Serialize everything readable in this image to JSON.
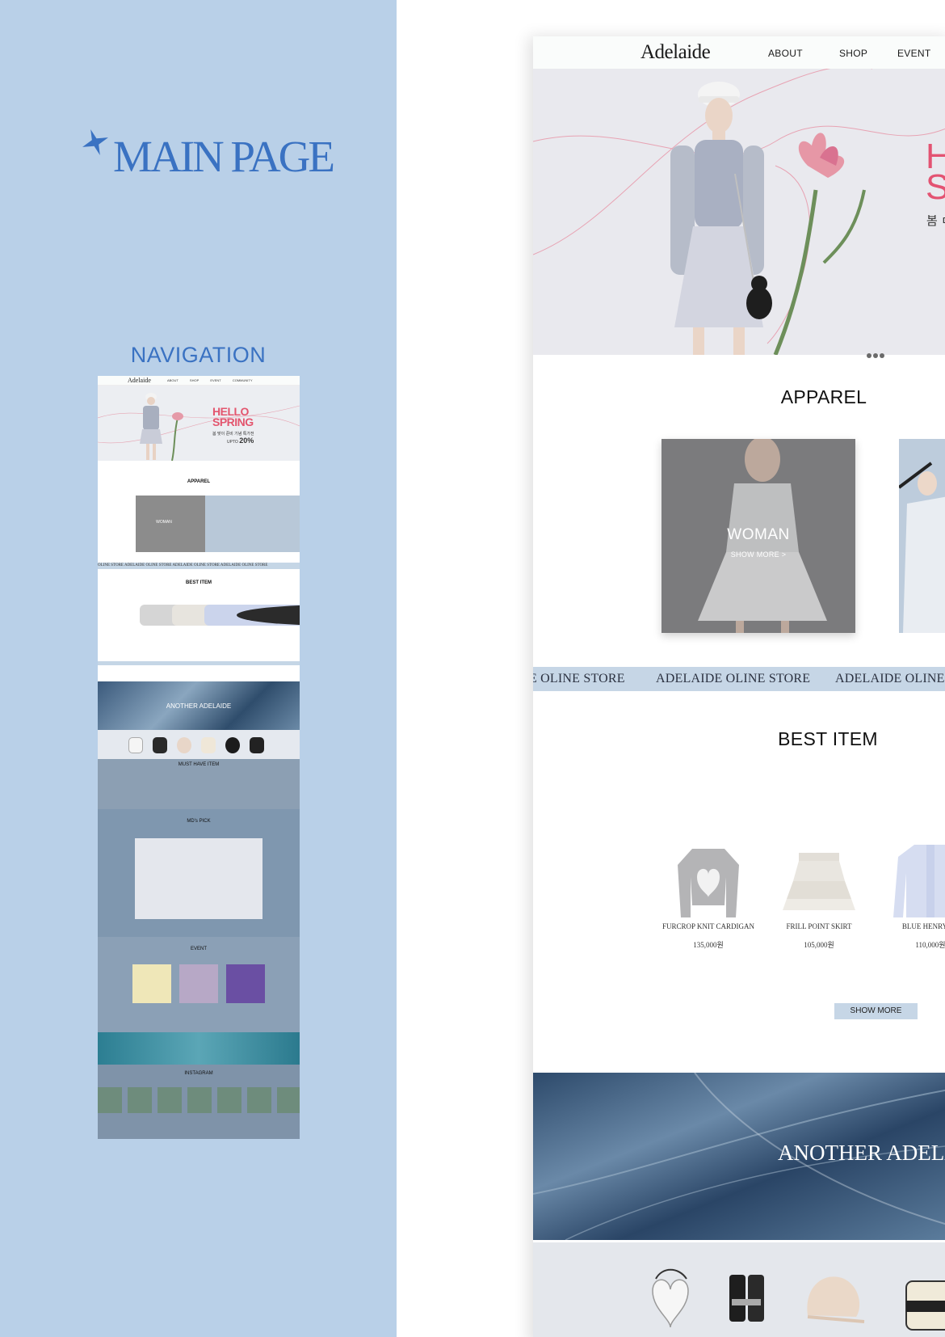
{
  "left": {
    "title": "MAIN PAGE",
    "subtitle": "NAVIGATION"
  },
  "mini": {
    "logo": "Adelaide",
    "nav": [
      "ABOUT",
      "SHOP",
      "EVENT",
      "COMMUNITY"
    ],
    "hero_title": "HELLO SPRING",
    "hero_sub": "봄 맞이 준비 기념 특가전",
    "hero_upto": "UPTO",
    "hero_percent": "20%",
    "apparel": "APPAREL",
    "woman": "WOMAN",
    "marquee": "OLINE STORE   ADELAIDE OLINE STORE   ADELAIDE OLINE STORE   ADELAIDE OLINE STORE",
    "best": "BEST ITEM",
    "another": "ANOTHER ADELAIDE",
    "must": "MUST HAVE ITEM",
    "mds": "MD's PICK",
    "event": "EVENT",
    "insta": "INSTAGRAM"
  },
  "page": {
    "logo": "Adelaide",
    "nav": {
      "about": "ABOUT",
      "shop": "SHOP",
      "event": "EVENT"
    },
    "hero": {
      "title_line1": "H",
      "title_line2": "S",
      "sub": "봄 ㅁ"
    },
    "apparel_title": "APPAREL",
    "woman_label": "WOMAN",
    "woman_more": "SHOW MORE >",
    "marquee": [
      "E OLINE STORE",
      "ADELAIDE OLINE STORE",
      "ADELAIDE OLINE S"
    ],
    "best_title": "BEST ITEM",
    "products": [
      {
        "name": "FURCROP KNIT CARDIGAN",
        "price": "135,000원"
      },
      {
        "name": "FRILL POINT SKIRT",
        "price": "105,000원"
      },
      {
        "name": "BLUE HENRY NE",
        "price": "110,000원"
      }
    ],
    "show_more": "SHOW MORE",
    "another": "ANOTHER ADELA"
  },
  "colors": {
    "panel": "#b9d0e8",
    "accent_blue": "#3a72c2",
    "hero_pink": "#e35372",
    "marquee_bg": "#c6d6e6"
  }
}
